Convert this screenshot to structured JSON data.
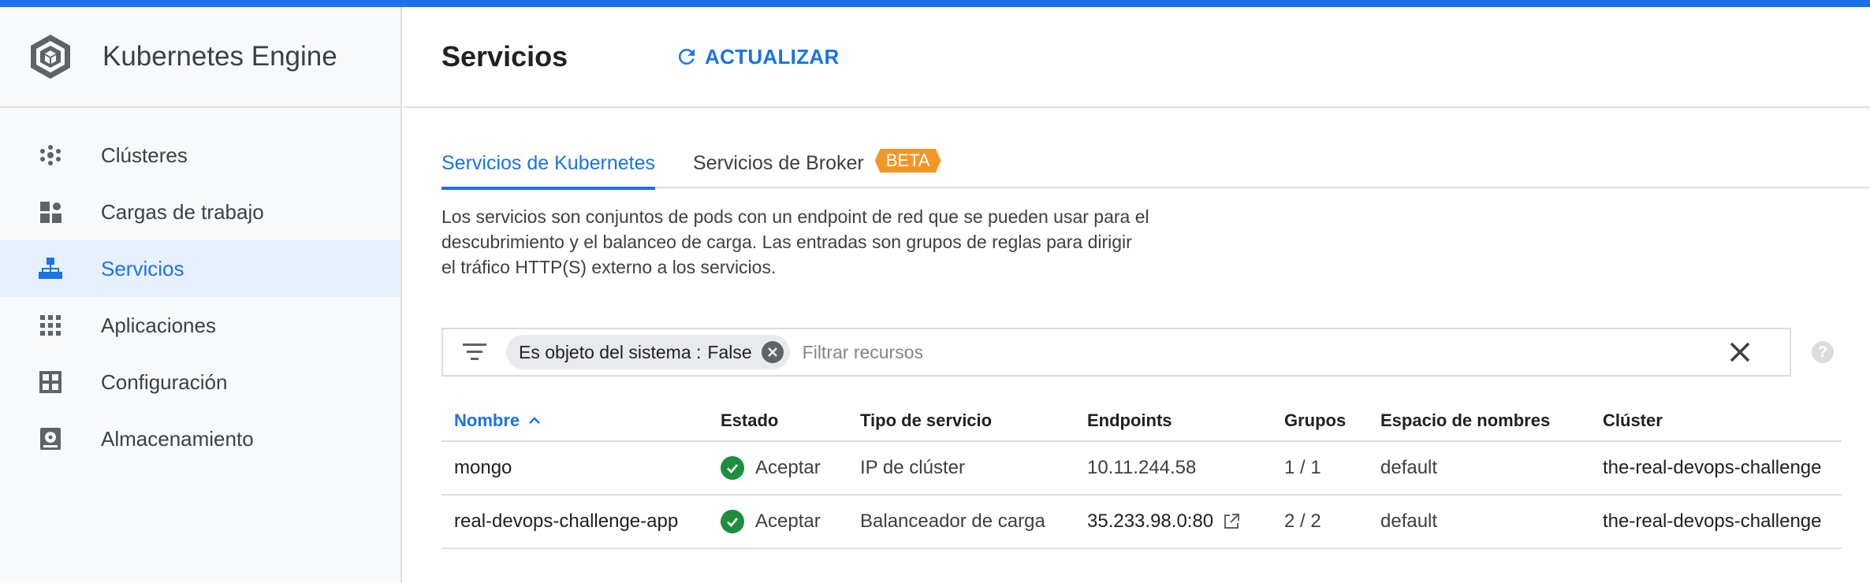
{
  "app": {
    "title": "Kubernetes Engine"
  },
  "sidebar": {
    "items": [
      {
        "label": "Clústeres",
        "icon": "clusters-icon",
        "active": false
      },
      {
        "label": "Cargas de trabajo",
        "icon": "workloads-icon",
        "active": false
      },
      {
        "label": "Servicios",
        "icon": "services-icon",
        "active": true
      },
      {
        "label": "Aplicaciones",
        "icon": "apps-grid-icon",
        "active": false
      },
      {
        "label": "Configuración",
        "icon": "configuration-icon",
        "active": false
      },
      {
        "label": "Almacenamiento",
        "icon": "storage-icon",
        "active": false
      }
    ]
  },
  "header": {
    "title": "Servicios",
    "refresh_label": "ACTUALIZAR"
  },
  "tabs": [
    {
      "label": "Servicios de Kubernetes",
      "active": true
    },
    {
      "label": "Servicios de Broker",
      "badge": "BETA",
      "active": false
    }
  ],
  "description": "Los servicios son conjuntos de pods con un endpoint de red que se pueden usar para el descubrimiento y el balanceo de carga. Las entradas son grupos de reglas para dirigir el tráfico HTTP(S) externo a los servicios.",
  "filter": {
    "chip_key": "Es objeto del sistema :",
    "chip_value": "False",
    "placeholder": "Filtrar recursos",
    "help": "?"
  },
  "table": {
    "columns": [
      "Nombre",
      "Estado",
      "Tipo de servicio",
      "Endpoints",
      "Grupos",
      "Espacio de nombres",
      "Clúster"
    ],
    "sort_column": "Nombre",
    "rows": [
      {
        "name": "mongo",
        "status": "Aceptar",
        "type": "IP de clúster",
        "endpoints": "10.11.244.58",
        "groups": "1 / 1",
        "namespace": "default",
        "cluster": "the-real-devops-challenge",
        "external_link": false
      },
      {
        "name": "real-devops-challenge-app",
        "status": "Aceptar",
        "type": "Balanceador de carga",
        "endpoints": "35.233.98.0:80",
        "groups": "2 / 2",
        "namespace": "default",
        "cluster": "the-real-devops-challenge",
        "external_link": true
      }
    ]
  },
  "colors": {
    "accent": "#1a73e8",
    "beta": "#f29727",
    "ok": "#1e8e3e"
  }
}
